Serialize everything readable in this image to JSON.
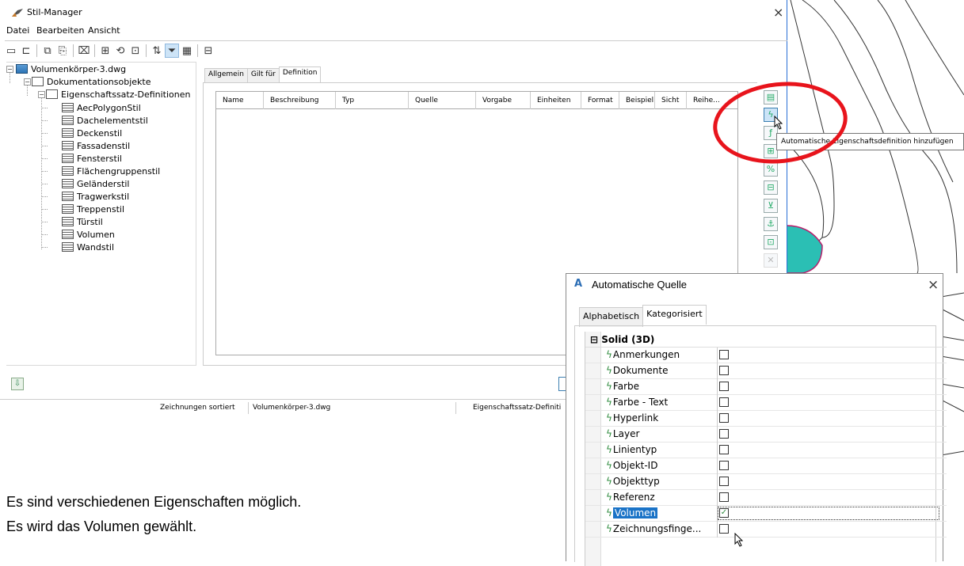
{
  "window": {
    "title": "Stil-Manager",
    "close": "×"
  },
  "menu": [
    "Datei",
    "Bearbeiten",
    "Ansicht"
  ],
  "toolbar": {
    "icons": [
      "new-icon",
      "open-icon",
      "copy-icon",
      "paste-icon",
      "purge-icon",
      "new-style-icon",
      "edit-style-icon",
      "select-style-icon",
      "sort-icon",
      "filter-icon",
      "view-icon",
      "inventory-icon"
    ]
  },
  "tree": {
    "root": "Volumenkörper-3.dwg",
    "level1": "Dokumentationsobjekte",
    "level2": "Eigenschaftssatz-Definitionen",
    "items": [
      "AecPolygonStil",
      "Dachelementstil",
      "Deckenstil",
      "Fassadenstil",
      "Fensterstil",
      "Flächengruppenstil",
      "Geländerstil",
      "Tragwerkstil",
      "Treppenstil",
      "Türstil",
      "Volumen",
      "Wandstil"
    ]
  },
  "tabs": [
    "Allgemein",
    "Gilt für",
    "Definition"
  ],
  "grid": {
    "columns": [
      "Name",
      "Beschreibung",
      "Typ",
      "Quelle",
      "Vorgabe",
      "Einheiten",
      "Format",
      "Beispiel",
      "Sicht",
      "Reihe..."
    ]
  },
  "side_buttons": [
    "add-property-definition-icon",
    "add-automatic-property-icon",
    "add-formula-icon",
    "add-location-icon",
    "add-classification-icon",
    "add-material-icon",
    "add-graphic-icon",
    "add-anchor-icon",
    "add-project-icon",
    "delete-icon"
  ],
  "tooltip": "Automatische Eigenschaftsdefinition hinzufügen",
  "status": {
    "sorted": "Zeichnungen sortiert",
    "file": "Volumenkörper-3.dwg",
    "type": "Eigenschaftssatz-Definiti"
  },
  "notes": [
    "Es sind verschiedenen Eigenschaften möglich.",
    "Es wird das Volumen gewählt."
  ],
  "dialog": {
    "logo": "A",
    "title": "Automatische Quelle",
    "close": "×",
    "tabs": [
      "Alphabetisch",
      "Kategorisiert"
    ],
    "category": "⊟ Solid (3D)",
    "properties": [
      {
        "label": "Anmerkungen",
        "checked": false
      },
      {
        "label": "Dokumente",
        "checked": false
      },
      {
        "label": "Farbe",
        "checked": false
      },
      {
        "label": "Farbe - Text",
        "checked": false
      },
      {
        "label": "Hyperlink",
        "checked": false
      },
      {
        "label": "Layer",
        "checked": false
      },
      {
        "label": "Linientyp",
        "checked": false
      },
      {
        "label": "Objekt-ID",
        "checked": false
      },
      {
        "label": "Objekttyp",
        "checked": false
      },
      {
        "label": "Referenz",
        "checked": false
      },
      {
        "label": "Volumen",
        "checked": true
      },
      {
        "label": "Zeichnungsfinge...",
        "checked": false
      }
    ]
  }
}
